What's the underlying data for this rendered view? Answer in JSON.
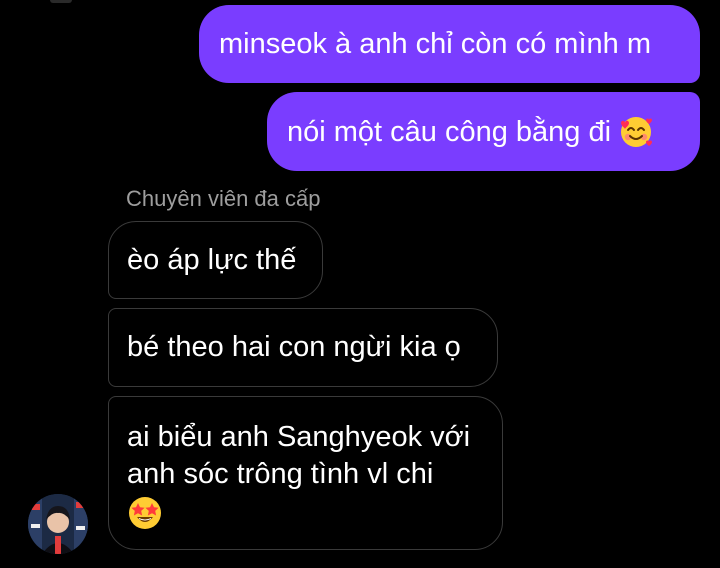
{
  "chat": {
    "messages_out": [
      {
        "text": "minseok à anh chỉ còn có mình m"
      },
      {
        "text": "nói một câu công bằng đi",
        "emoji": "smiling-face-with-hearts-icon"
      }
    ],
    "sender_name": "Chuyên viên đa cấp",
    "messages_in": [
      {
        "text": "èo áp lực thế"
      },
      {
        "text": "bé theo hai con ngừi kia ọ"
      },
      {
        "lines": [
          "ai biểu anh Sanghyeok với",
          "anh sóc trông tình vl chi"
        ],
        "emoji": "star-struck-icon"
      }
    ]
  },
  "colors": {
    "background": "#000000",
    "outgoing_bubble": "#7a3dff",
    "incoming_bubble_border": "#3a3a3a",
    "sender_name": "#9e9e9e"
  }
}
